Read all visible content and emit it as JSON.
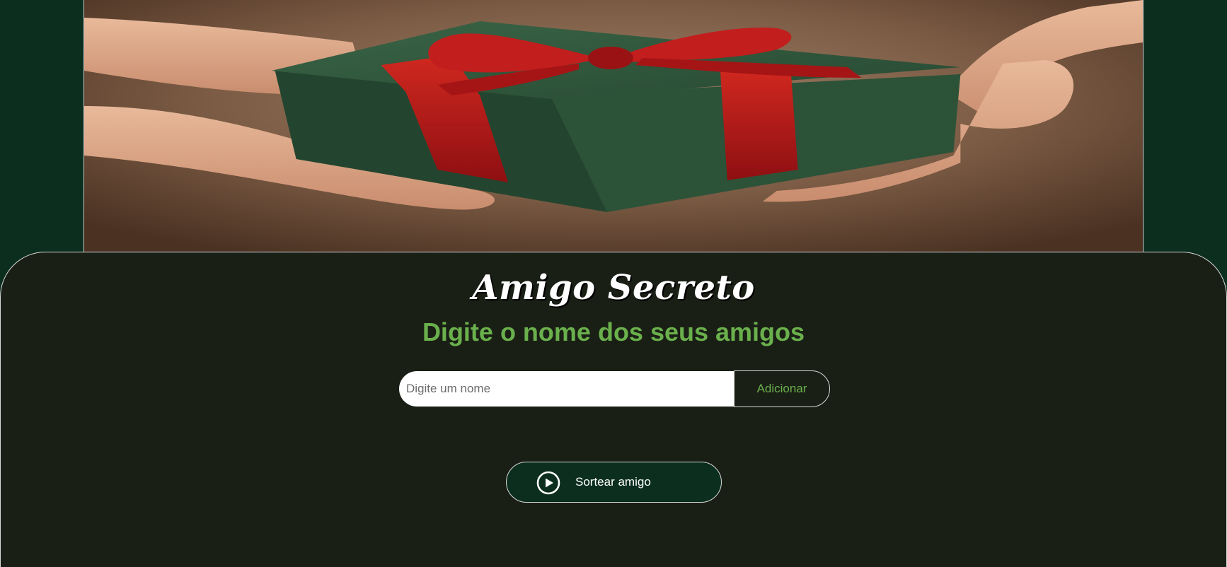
{
  "page": {
    "title": "Amigo Secreto",
    "subtitle": "Digite o nome dos seus amigos"
  },
  "banner": {
    "image": "hands-holding-gift-box"
  },
  "form": {
    "name_input_placeholder": "Digite um nome",
    "name_input_value": "",
    "add_button_label": "Adicionar"
  },
  "draw": {
    "button_label": "Sortear amigo",
    "icon": "play-circle-icon"
  },
  "colors": {
    "page_background": "#0b2e1f",
    "panel_background": "#1a1f16",
    "accent_green": "#6ab04c",
    "title_white": "#ffffff",
    "gift_green": "#2f5538",
    "ribbon_red": "#b5171a"
  }
}
